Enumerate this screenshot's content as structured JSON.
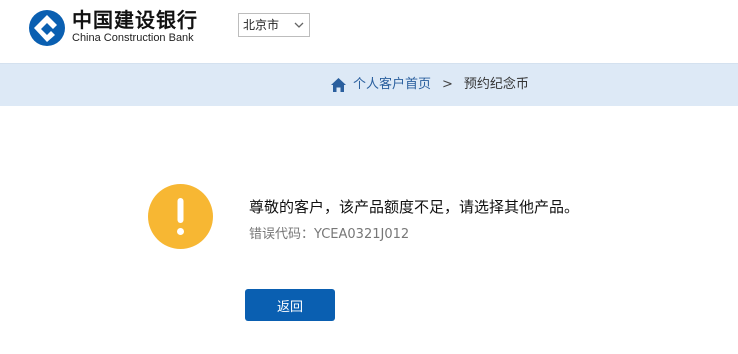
{
  "header": {
    "logo_cn": "中国建设银行",
    "logo_en": "China Construction Bank",
    "logo_icon": "ccb-logo-icon",
    "city_select": {
      "selected": "北京市",
      "icon": "chevron-down-icon"
    }
  },
  "breadcrumb": {
    "home_icon": "home-icon",
    "home_label": "个人客户首页",
    "separator": ">",
    "current_label": "预约纪念币"
  },
  "message": {
    "icon": "warning-exclamation-icon",
    "main_text": "尊敬的客户，该产品额度不足，请选择其他产品。",
    "error_code_text": "错误代码：YCEA0321J012"
  },
  "actions": {
    "back_label": "返回"
  },
  "colors": {
    "brand_blue": "#0a5fb1",
    "breadcrumb_bg": "#dde9f6",
    "warning_orange": "#f7b733",
    "link_blue": "#2a5f9e"
  }
}
